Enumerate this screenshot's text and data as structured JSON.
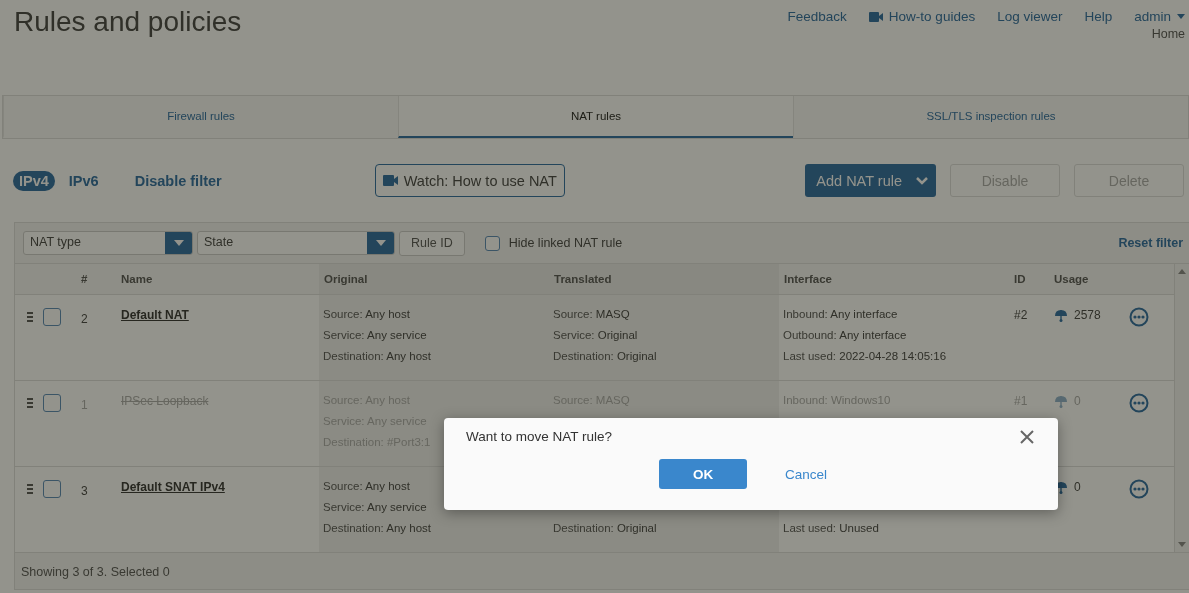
{
  "page": {
    "title": "Rules and policies",
    "breadcrumb": "Home"
  },
  "top_links": [
    {
      "label": "Feedback",
      "kind": "link"
    },
    {
      "label": "How-to guides",
      "kind": "video"
    },
    {
      "label": "Log viewer",
      "kind": "link"
    },
    {
      "label": "Help",
      "kind": "link"
    },
    {
      "label": "admin",
      "kind": "menu"
    }
  ],
  "tabs": [
    {
      "label": "Firewall rules",
      "selected": false
    },
    {
      "label": "NAT rules",
      "selected": true
    },
    {
      "label": "SSL/TLS inspection rules",
      "selected": false
    }
  ],
  "ip_toggle": [
    {
      "label": "IPv4",
      "selected": true
    },
    {
      "label": "IPv6",
      "selected": false
    }
  ],
  "disable_filter": "Disable filter",
  "watch_button": "Watch: How to use NAT",
  "add_button": "Add NAT rule",
  "actions": [
    {
      "label": "Disable",
      "disabled": true
    },
    {
      "label": "Delete",
      "disabled": true
    }
  ],
  "filters": {
    "nat_type": "NAT type",
    "state": "State",
    "rule_id": "Rule ID",
    "hide_linked": {
      "label": "Hide linked NAT rule",
      "checked": false
    },
    "reset": "Reset filter"
  },
  "table": {
    "columns": [
      "#",
      "Name",
      "Original",
      "Translated",
      "Interface",
      "ID",
      "Usage"
    ],
    "rows": [
      {
        "selected": false,
        "number": "2",
        "name": "Default NAT",
        "disabled": false,
        "original": [
          {
            "label": "Source:",
            "value": "Any host"
          },
          {
            "label": "Service:",
            "value": "Any service"
          },
          {
            "label": "Destination:",
            "value": "Any host"
          }
        ],
        "translated": [
          {
            "label": "Source:",
            "value": "MASQ"
          },
          {
            "label": "Service:",
            "value": "Original"
          },
          {
            "label": "Destination:",
            "value": "Original"
          }
        ],
        "interface": [
          {
            "label": "Inbound:",
            "value": "Any interface"
          },
          {
            "label": "Outbound:",
            "value": "Any interface"
          },
          {
            "label": "Last used:",
            "value": "2022-04-28 14:05:16"
          }
        ],
        "id": "#2",
        "usage": "2578"
      },
      {
        "selected": false,
        "number": "1",
        "name": "IPSec Loopback",
        "disabled": true,
        "original": [
          {
            "label": "Source:",
            "value": "Any host"
          },
          {
            "label": "Service:",
            "value": "Any service"
          },
          {
            "label": "Destination:",
            "value": "#Port3:1"
          }
        ],
        "translated": [
          {
            "label": "Source:",
            "value": "MASQ"
          }
        ],
        "interface": [
          {
            "label": "Inbound:",
            "value": "Windows10"
          }
        ],
        "id": "#1",
        "usage": "0"
      },
      {
        "selected": false,
        "number": "3",
        "name": "Default SNAT IPv4",
        "disabled": false,
        "original": [
          {
            "label": "Source:",
            "value": "Any host"
          },
          {
            "label": "Service:",
            "value": "Any service"
          },
          {
            "label": "Destination:",
            "value": "Any host"
          }
        ],
        "translated": [
          {
            "kind": "destination",
            "label": "Destination:",
            "value": "Original"
          }
        ],
        "interface": [
          {
            "kind": "last_used",
            "label": "Last used:",
            "value": "Unused"
          }
        ],
        "usage": "0"
      }
    ]
  },
  "status": "Showing 3 of 3. Selected 0",
  "dialog": {
    "message": "Want to move NAT rule?",
    "ok": "OK",
    "cancel": "Cancel"
  }
}
